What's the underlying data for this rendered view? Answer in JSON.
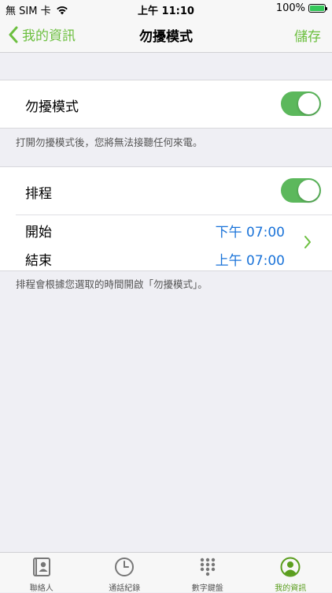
{
  "status_bar": {
    "carrier": "無 SIM 卡",
    "time": "上午 11:10",
    "battery": "100%"
  },
  "nav": {
    "back_label": "我的資訊",
    "title": "勿擾模式",
    "save_label": "儲存"
  },
  "dnd": {
    "label": "勿擾模式",
    "enabled": true,
    "note": "打開勿擾模式後，您將無法接聽任何來電。"
  },
  "schedule": {
    "label": "排程",
    "enabled": true,
    "start_label": "開始",
    "start_value": "下午 07:00",
    "end_label": "結束",
    "end_value": "上午 07:00",
    "note": "排程會根據您選取的時間開啟「勿擾模式」。"
  },
  "tabs": [
    {
      "label": "聯絡人",
      "icon": "contacts-icon",
      "active": false
    },
    {
      "label": "通話紀錄",
      "icon": "clock-icon",
      "active": false
    },
    {
      "label": "數字鍵盤",
      "icon": "keypad-icon",
      "active": false
    },
    {
      "label": "我的資訊",
      "icon": "profile-icon",
      "active": true
    }
  ],
  "colors": {
    "accent": "#6cbf3f",
    "toggle_on": "#5cb85c",
    "time_blue": "#1a73d9",
    "background": "#efeff4"
  }
}
